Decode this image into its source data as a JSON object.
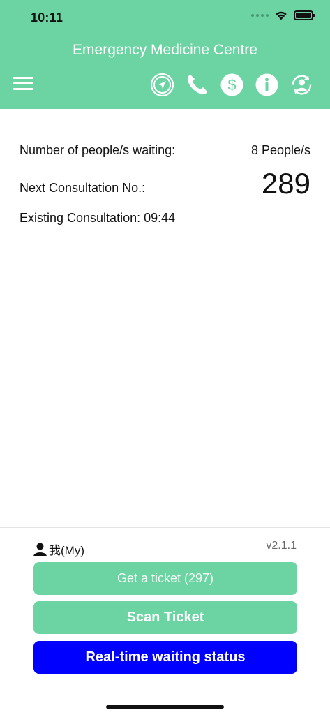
{
  "status_bar": {
    "time": "10:11"
  },
  "header": {
    "title": "Emergency Medicine Centre",
    "background_color": "#6cd3a3",
    "icons": [
      "menu-icon",
      "location-icon",
      "phone-icon",
      "dollar-icon",
      "info-icon",
      "user-refresh-icon"
    ]
  },
  "info": {
    "waiting_label": "Number of people/s waiting:",
    "waiting_value": "8 People/s",
    "next_label": "Next Consultation No.:",
    "next_value": "289",
    "existing_label": "Existing Consultation:",
    "existing_value": "09:44"
  },
  "bottom": {
    "user_label": "我(My)",
    "version": "v2.1.1",
    "get_ticket_label": "Get a ticket (297)",
    "scan_ticket_label": "Scan Ticket",
    "status_label": "Real-time waiting status",
    "accent_green": "#6cd3a3",
    "accent_blue": "#0000ff"
  }
}
